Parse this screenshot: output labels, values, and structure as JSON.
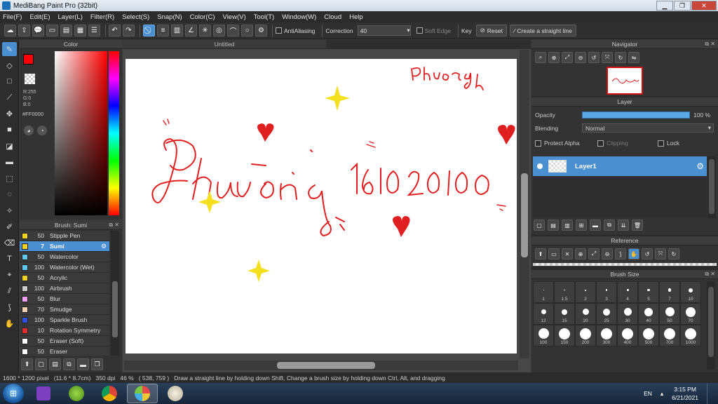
{
  "window": {
    "title": "MediBang Paint Pro (32bit)"
  },
  "menu": [
    "File(F)",
    "Edit(E)",
    "Layer(L)",
    "Filter(R)",
    "Select(S)",
    "Snap(N)",
    "Color(C)",
    "View(V)",
    "Tool(T)",
    "Window(W)",
    "Cloud",
    "Help"
  ],
  "toolbar": {
    "antialiasing_label": "AntiAliasing",
    "correction_label": "Correction",
    "correction_value": "40",
    "soft_edge_label": "Soft Edge",
    "key_label": "Key",
    "reset_label": "Reset",
    "straight_line_label": "Create a straight line"
  },
  "color_panel": {
    "title": "Color",
    "r": "R:255",
    "g": "G:0",
    "b": "B:0",
    "hex": "#FF0000",
    "fg_color": "#ff0000"
  },
  "brush_panel": {
    "title": "Brush: Sumi",
    "items": [
      {
        "size": "50",
        "name": "Stipple Pen",
        "color": "#f0d020"
      },
      {
        "size": "7",
        "name": "Sumi",
        "color": "#f0d020",
        "active": true
      },
      {
        "size": "50",
        "name": "Watercolor",
        "color": "#60c8f0"
      },
      {
        "size": "100",
        "name": "Watercolor (Wet)",
        "color": "#60c8f0"
      },
      {
        "size": "50",
        "name": "Acrylic",
        "color": "#f0d020"
      },
      {
        "size": "100",
        "name": "Airbrush",
        "color": "#cccccc"
      },
      {
        "size": "50",
        "name": "Blur",
        "color": "#f0a0f0"
      },
      {
        "size": "70",
        "name": "Smudge",
        "color": "#f0d0b0"
      },
      {
        "size": "100",
        "name": "Sparkle Brush",
        "color": "#3050e0"
      },
      {
        "size": "10",
        "name": "Rotation Symmetry P",
        "color": "#e03030"
      },
      {
        "size": "50",
        "name": "Eraser (Soft)",
        "color": "#ffffff"
      },
      {
        "size": "50",
        "name": "Eraser",
        "color": "#ffffff"
      }
    ]
  },
  "document": {
    "tab": "Untitled"
  },
  "navigator": {
    "title": "Navigator"
  },
  "layer_panel": {
    "title": "Layer",
    "opacity_label": "Opacity",
    "opacity_value": "100 %",
    "opacity_fraction": 1.0,
    "blending_label": "Blending",
    "blending_value": "Normal",
    "protect_alpha": "Protect Alpha",
    "clipping": "Clipping",
    "lock": "Lock",
    "layer_name": "Layer1"
  },
  "reference": {
    "title": "Reference"
  },
  "brush_size": {
    "title": "Brush Size",
    "sizes": [
      "1",
      "1.5",
      "2",
      "3",
      "4",
      "5",
      "7",
      "10",
      "12",
      "15",
      "20",
      "25",
      "30",
      "40",
      "50",
      "70",
      "100",
      "150",
      "200",
      "300",
      "400",
      "500",
      "700",
      "1000"
    ]
  },
  "status": {
    "size": "1600 * 1200 pixel",
    "physical": "(11.6 * 8.7cm)",
    "dpi": "350 dpi",
    "zoom": "46 %",
    "coords": "( 538, 759 )",
    "hint": "Draw a straight line by holding down Shift, Change a brush size by holding down Ctrl, Alt, and dragging"
  },
  "taskbar": {
    "lang": "EN",
    "time": "3:15 PM",
    "date": "6/21/2021"
  }
}
